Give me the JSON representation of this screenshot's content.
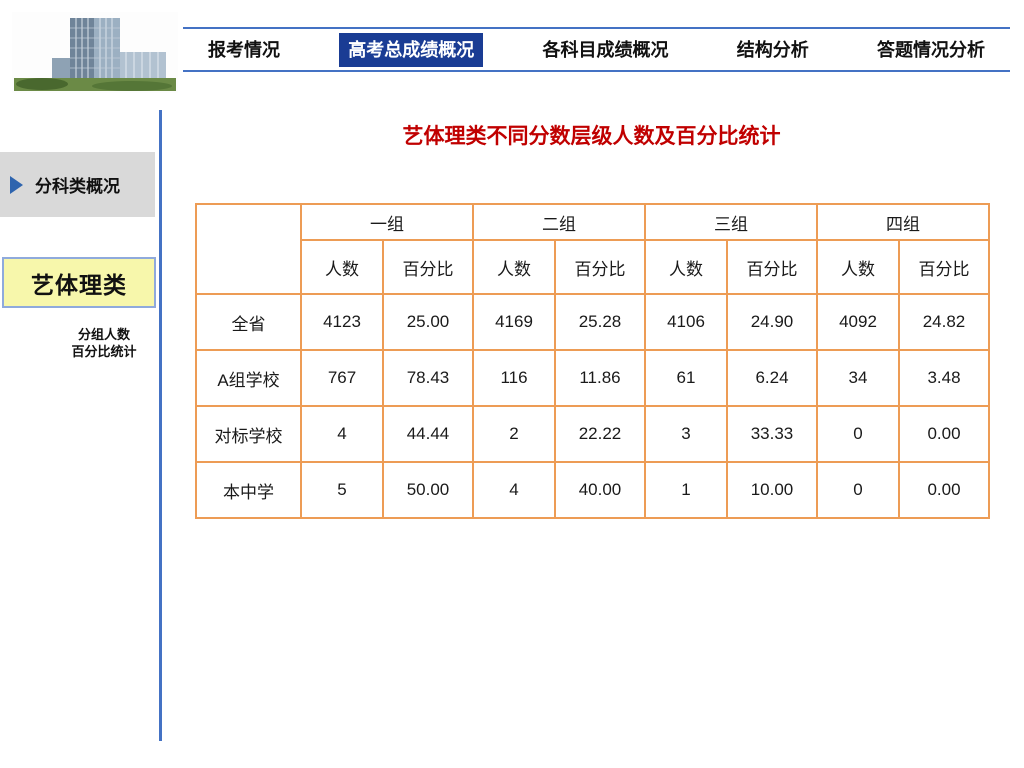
{
  "nav": {
    "tabs": [
      {
        "label": "报考情况",
        "selected": false
      },
      {
        "label": "高考总成绩概况",
        "selected": true
      },
      {
        "label": "各科目成绩概况",
        "selected": false
      },
      {
        "label": "结构分析",
        "selected": false
      },
      {
        "label": "答题情况分析",
        "selected": false
      }
    ]
  },
  "sidebar": {
    "section_label": "分科类概况",
    "category_label": "艺体理类",
    "sub_label_line1": "分组人数",
    "sub_label_line2": "百分比统计"
  },
  "main": {
    "title": "艺体理类不同分数层级人数及百分比统计",
    "table": {
      "group_headers": [
        "一组",
        "二组",
        "三组",
        "四组"
      ],
      "sub_headers": [
        "人数",
        "百分比"
      ],
      "rows": [
        {
          "label": "全省",
          "values": [
            "4123",
            "25.00",
            "4169",
            "25.28",
            "4106",
            "24.90",
            "4092",
            "24.82"
          ]
        },
        {
          "label": "A组学校",
          "values": [
            "767",
            "78.43",
            "116",
            "11.86",
            "61",
            "6.24",
            "34",
            "3.48"
          ]
        },
        {
          "label": "对标学校",
          "values": [
            "4",
            "44.44",
            "2",
            "22.22",
            "3",
            "33.33",
            "0",
            "0.00"
          ]
        },
        {
          "label": "本中学",
          "values": [
            "5",
            "50.00",
            "4",
            "40.00",
            "1",
            "10.00",
            "0",
            "0.00"
          ]
        }
      ]
    }
  },
  "icons": {
    "sidebar_arrow": "play-triangle",
    "logo": "office-building-photo"
  },
  "colors": {
    "accent_blue": "#4472C4",
    "selected_tab_bg": "#1A3C94",
    "table_border": "#ED9C55",
    "title_red": "#C00000",
    "sidebar_gray": "#D9D9D9",
    "highlight_yellow": "#F7F7AB",
    "highlight_border": "#8FAADC"
  }
}
